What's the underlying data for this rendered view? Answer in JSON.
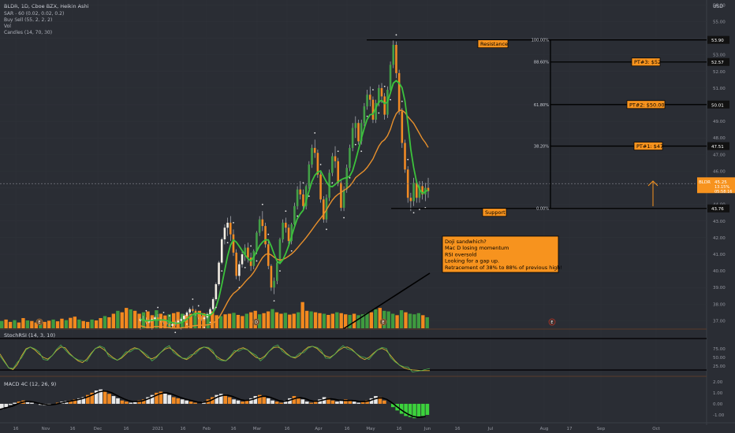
{
  "header": {
    "symbol_line": "BLDR, 1D, Cboe BZX, Heikin Ashi",
    "indicators": [
      "SAR - 60 (0.02, 0.02, 0.2)",
      "Buy Sell (55, 2, 2, 2)",
      "Vol",
      "Candles (14, 70, 30)"
    ],
    "currency": "USD"
  },
  "colors": {
    "background": "#2a2d34",
    "up_candle": "#43a047",
    "down_candle": "#f08a24",
    "fast_ma": "#3cc23c",
    "slow_ma": "#e8902c",
    "volume_up": "#3f9b3f",
    "volume_down": "#f2891f",
    "level_line": "#000000",
    "label_bg": "#f7931e",
    "cursor_line": "#7a7d85"
  },
  "levels": {
    "resistance_label": "Resistance",
    "support_label": "Support",
    "fib_labels": [
      "100.00%",
      "88.60%",
      "61.80%",
      "38.20%",
      "0.00%"
    ],
    "price_tags": [
      "53.90",
      "52.57",
      "50.01",
      "47.51",
      "43.76"
    ],
    "targets": [
      "PT#3: $52",
      "PT#2: $50.00",
      "PT#1: $47"
    ]
  },
  "current_price": {
    "symbol": "BLDR",
    "value": "45.25",
    "change": "13.15%",
    "timer": "05:58:16"
  },
  "annotation": {
    "lines": [
      "Doji sandwhich?",
      "Mac D losing momentum",
      "RSI oversold",
      "Looking for a gap up.",
      "Retracement of 38% to 88% of previous high!"
    ]
  },
  "price_axis_ticks": [
    "56.00",
    "55.00",
    "54.00",
    "53.00",
    "52.00",
    "51.00",
    "50.00",
    "49.00",
    "48.00",
    "47.00",
    "46.00",
    "45.00",
    "44.00",
    "43.00",
    "42.00",
    "41.00",
    "40.00",
    "39.00",
    "38.00",
    "37.00"
  ],
  "stoch": {
    "label": "StochRSI (14, 3, 10)",
    "ticks": [
      "75.00",
      "50.00",
      "25.00"
    ]
  },
  "macd": {
    "label": "MACD 4C (12, 26, 9)",
    "ticks": [
      "2.00",
      "1.00",
      "0.00",
      "-1.00"
    ]
  },
  "time_axis": [
    "16",
    "Nov",
    "16",
    "Dec",
    "16",
    "2021",
    "16",
    "Feb",
    "16",
    "Mar",
    "16",
    "Apr",
    "16",
    "May",
    "16",
    "Jun",
    "16",
    "Jul",
    "Aug",
    "17",
    "Sep",
    "Oct"
  ],
  "event_markers": [
    "E",
    "D",
    "E",
    "E"
  ],
  "chart_data": {
    "type": "candlestick",
    "y_range": [
      36.5,
      56.3
    ],
    "candles": [
      [
        37.0,
        37.2,
        36.9,
        37.1
      ],
      [
        37.1,
        37.3,
        37.0,
        37.0
      ],
      [
        37.0,
        37.2,
        36.8,
        36.9
      ],
      [
        36.9,
        37.1,
        36.8,
        37.0
      ],
      [
        37.0,
        37.2,
        36.9,
        37.1
      ],
      [
        37.1,
        37.3,
        37.0,
        37.2
      ],
      [
        37.2,
        37.4,
        37.0,
        37.1
      ],
      [
        37.1,
        37.2,
        36.9,
        37.0
      ],
      [
        37.0,
        37.1,
        36.8,
        36.9
      ],
      [
        36.9,
        37.0,
        36.7,
        36.8
      ],
      [
        36.8,
        36.9,
        36.6,
        36.7
      ],
      [
        36.7,
        36.9,
        36.6,
        36.8
      ],
      [
        36.8,
        37.0,
        36.7,
        36.9
      ],
      [
        36.9,
        37.1,
        36.8,
        37.0
      ],
      [
        37.0,
        37.2,
        36.9,
        37.1
      ],
      [
        37.1,
        37.4,
        37.0,
        37.3
      ],
      [
        37.3,
        37.6,
        37.2,
        37.5
      ],
      [
        37.5,
        37.8,
        37.4,
        37.7
      ],
      [
        37.7,
        37.9,
        37.5,
        37.6
      ],
      [
        37.6,
        37.7,
        37.3,
        37.4
      ],
      [
        37.4,
        37.5,
        37.1,
        37.2
      ],
      [
        37.2,
        37.3,
        37.0,
        37.1
      ],
      [
        37.1,
        37.3,
        37.0,
        37.2
      ],
      [
        37.2,
        37.5,
        37.1,
        37.4
      ],
      [
        37.4,
        37.8,
        37.3,
        37.7
      ],
      [
        37.7,
        38.4,
        37.6,
        38.3
      ],
      [
        38.3,
        39.3,
        38.2,
        39.2
      ],
      [
        39.2,
        40.6,
        39.1,
        40.5
      ],
      [
        40.5,
        42.0,
        40.4,
        41.9
      ],
      [
        41.9,
        42.8,
        41.6,
        42.6
      ],
      [
        42.6,
        43.2,
        42.1,
        42.9
      ],
      [
        42.9,
        43.3,
        41.8,
        42.2
      ],
      [
        42.2,
        42.5,
        40.9,
        41.1
      ],
      [
        41.1,
        41.3,
        39.5,
        39.7
      ],
      [
        39.7,
        40.6,
        39.4,
        40.4
      ],
      [
        40.4,
        41.2,
        40.2,
        41.0
      ],
      [
        41.0,
        41.6,
        40.6,
        41.4
      ],
      [
        41.4,
        41.7,
        40.5,
        40.8
      ],
      [
        40.8,
        41.1,
        40.0,
        40.3
      ],
      [
        40.3,
        41.3,
        40.1,
        41.2
      ],
      [
        41.2,
        42.4,
        41.0,
        42.3
      ],
      [
        42.3,
        43.3,
        42.1,
        43.1
      ],
      [
        43.1,
        43.6,
        42.4,
        42.7
      ],
      [
        42.7,
        42.9,
        41.4,
        41.6
      ],
      [
        41.6,
        41.8,
        40.1,
        40.3
      ],
      [
        40.3,
        40.4,
        38.8,
        39.0
      ],
      [
        39.0,
        39.6,
        38.6,
        39.4
      ],
      [
        39.4,
        40.6,
        39.2,
        40.5
      ],
      [
        40.5,
        42.0,
        40.4,
        41.9
      ],
      [
        41.9,
        43.1,
        41.7,
        42.9
      ],
      [
        42.9,
        43.2,
        42.3,
        42.6
      ],
      [
        42.6,
        42.8,
        41.6,
        41.8
      ],
      [
        41.8,
        42.9,
        41.6,
        42.8
      ],
      [
        42.8,
        44.1,
        42.6,
        43.9
      ],
      [
        43.9,
        45.1,
        43.7,
        44.9
      ],
      [
        44.9,
        45.4,
        44.3,
        44.6
      ],
      [
        44.6,
        44.9,
        43.7,
        43.9
      ],
      [
        43.9,
        45.2,
        43.7,
        45.1
      ],
      [
        45.1,
        46.6,
        44.9,
        46.4
      ],
      [
        46.4,
        47.6,
        46.2,
        47.4
      ],
      [
        47.4,
        47.9,
        46.8,
        47.1
      ],
      [
        47.1,
        47.3,
        45.6,
        45.8
      ],
      [
        45.8,
        46.0,
        44.1,
        44.3
      ],
      [
        44.3,
        44.5,
        42.9,
        43.1
      ],
      [
        43.1,
        44.6,
        42.9,
        44.4
      ],
      [
        44.4,
        46.1,
        44.2,
        45.9
      ],
      [
        45.9,
        47.1,
        45.7,
        46.9
      ],
      [
        46.9,
        47.5,
        46.2,
        46.6
      ],
      [
        46.6,
        46.8,
        45.1,
        45.3
      ],
      [
        45.3,
        45.5,
        43.6,
        43.8
      ],
      [
        43.8,
        45.1,
        43.6,
        44.9
      ],
      [
        44.9,
        46.4,
        44.7,
        46.2
      ],
      [
        46.2,
        47.6,
        46.0,
        47.4
      ],
      [
        47.4,
        48.9,
        47.2,
        48.6
      ],
      [
        48.6,
        49.3,
        48.0,
        48.9
      ],
      [
        48.9,
        49.1,
        47.6,
        47.8
      ],
      [
        47.8,
        49.1,
        47.6,
        48.9
      ],
      [
        48.9,
        50.1,
        48.7,
        49.9
      ],
      [
        49.9,
        50.9,
        49.7,
        50.6
      ],
      [
        50.6,
        51.1,
        49.9,
        50.3
      ],
      [
        50.3,
        50.5,
        48.9,
        49.1
      ],
      [
        49.1,
        50.3,
        48.9,
        50.1
      ],
      [
        50.1,
        51.2,
        49.9,
        51.0
      ],
      [
        51.0,
        51.3,
        50.1,
        50.5
      ],
      [
        50.5,
        50.7,
        49.1,
        49.4
      ],
      [
        49.4,
        51.1,
        49.2,
        50.9
      ],
      [
        50.9,
        52.6,
        50.7,
        52.4
      ],
      [
        52.4,
        53.9,
        52.2,
        53.6
      ],
      [
        53.6,
        53.8,
        51.6,
        51.9
      ],
      [
        51.9,
        52.1,
        49.4,
        49.6
      ],
      [
        49.6,
        49.8,
        47.4,
        47.7
      ],
      [
        47.7,
        47.9,
        45.9,
        46.1
      ],
      [
        46.1,
        46.3,
        44.1,
        44.4
      ],
      [
        44.4,
        44.7,
        43.6,
        44.2
      ],
      [
        44.2,
        45.6,
        43.9,
        45.3
      ],
      [
        45.3,
        45.5,
        44.1,
        44.4
      ],
      [
        44.4,
        45.4,
        44.1,
        45.1
      ],
      [
        45.1,
        45.4,
        44.3,
        44.6
      ],
      [
        44.6,
        45.3,
        44.2,
        45.0
      ],
      [
        45.0,
        45.6,
        44.4,
        44.8
      ]
    ],
    "levels": [
      53.9,
      52.57,
      50.01,
      47.51,
      43.76
    ],
    "current": 45.25,
    "volume": [
      0.25,
      0.3,
      0.22,
      0.28,
      0.2,
      0.35,
      0.27,
      0.25,
      0.2,
      0.18,
      0.22,
      0.26,
      0.3,
      0.24,
      0.33,
      0.28,
      0.36,
      0.4,
      0.3,
      0.25,
      0.22,
      0.3,
      0.27,
      0.35,
      0.42,
      0.38,
      0.5,
      0.6,
      0.55,
      0.7,
      0.65,
      0.6,
      0.5,
      0.55,
      0.58,
      0.45,
      0.62,
      0.5,
      0.44,
      0.48,
      0.52,
      0.56,
      0.5,
      0.46,
      0.5,
      0.55,
      0.6,
      0.52,
      0.5,
      0.58,
      0.45,
      0.42,
      0.48,
      0.5,
      0.53,
      0.46,
      0.42,
      0.5,
      0.55,
      0.6,
      0.48,
      0.52,
      0.58,
      0.66,
      0.55,
      0.5,
      0.53,
      0.47,
      0.5,
      0.55,
      0.9,
      0.6,
      0.58,
      0.55,
      0.52,
      0.5,
      0.46,
      0.5,
      0.55,
      0.52,
      0.48,
      0.46,
      0.5,
      0.45,
      0.48,
      0.52,
      0.55,
      0.65,
      0.7,
      0.6,
      0.58,
      0.5,
      0.45,
      0.62,
      0.55,
      0.5,
      0.48,
      0.52,
      0.45,
      0.38
    ],
    "stoch_k": [
      60,
      40,
      20,
      15,
      30,
      55,
      75,
      80,
      72,
      60,
      50,
      45,
      55,
      70,
      80,
      78,
      62,
      50,
      40,
      35,
      45,
      62,
      76,
      80,
      72,
      60,
      50,
      42,
      48,
      60,
      72,
      78,
      74,
      62,
      50,
      46,
      52,
      64,
      74,
      78,
      70,
      58,
      48,
      44,
      52,
      66,
      76,
      80,
      76,
      64,
      52,
      44,
      40,
      50,
      64,
      74,
      78,
      72,
      60,
      50,
      46,
      54,
      68,
      78,
      80,
      74,
      62,
      52,
      48,
      56,
      70,
      80,
      82,
      76,
      64,
      54,
      50,
      58,
      70,
      78,
      80,
      74,
      62,
      50,
      44,
      50,
      62,
      72,
      76,
      70,
      55,
      40,
      28,
      20,
      16,
      14,
      13,
      12,
      12,
      12
    ],
    "macd_hist": [
      -0.5,
      -0.3,
      -0.1,
      0.1,
      0.2,
      0.3,
      0.2,
      0.1,
      0,
      -0.1,
      -0.15,
      -0.1,
      0,
      0.1,
      0.2,
      0.25,
      0.3,
      0.4,
      0.5,
      0.6,
      0.8,
      1.0,
      1.2,
      1.3,
      1.1,
      0.9,
      0.7,
      0.5,
      0.3,
      0.2,
      0.1,
      0.2,
      0.3,
      0.4,
      0.6,
      0.8,
      1.0,
      1.1,
      1.0,
      0.8,
      0.6,
      0.5,
      0.4,
      0.3,
      0.2,
      0.1,
      0,
      0.2,
      0.4,
      0.6,
      0.8,
      0.9,
      0.8,
      0.6,
      0.4,
      0.3,
      0.2,
      0.3,
      0.5,
      0.7,
      0.8,
      0.7,
      0.5,
      0.3,
      0.2,
      0.1,
      0.3,
      0.5,
      0.7,
      0.6,
      0.4,
      0.2,
      0.1,
      0.2,
      0.4,
      0.6,
      0.5,
      0.3,
      0.2,
      0.3,
      0.4,
      0.3,
      0.2,
      0.1,
      0.2,
      0.3,
      0.5,
      0.7,
      0.6,
      0.3,
      0,
      -0.3,
      -0.6,
      -0.9,
      -1.1,
      -1.2,
      -1.3,
      -1.2,
      -1.1,
      -1.0
    ]
  }
}
